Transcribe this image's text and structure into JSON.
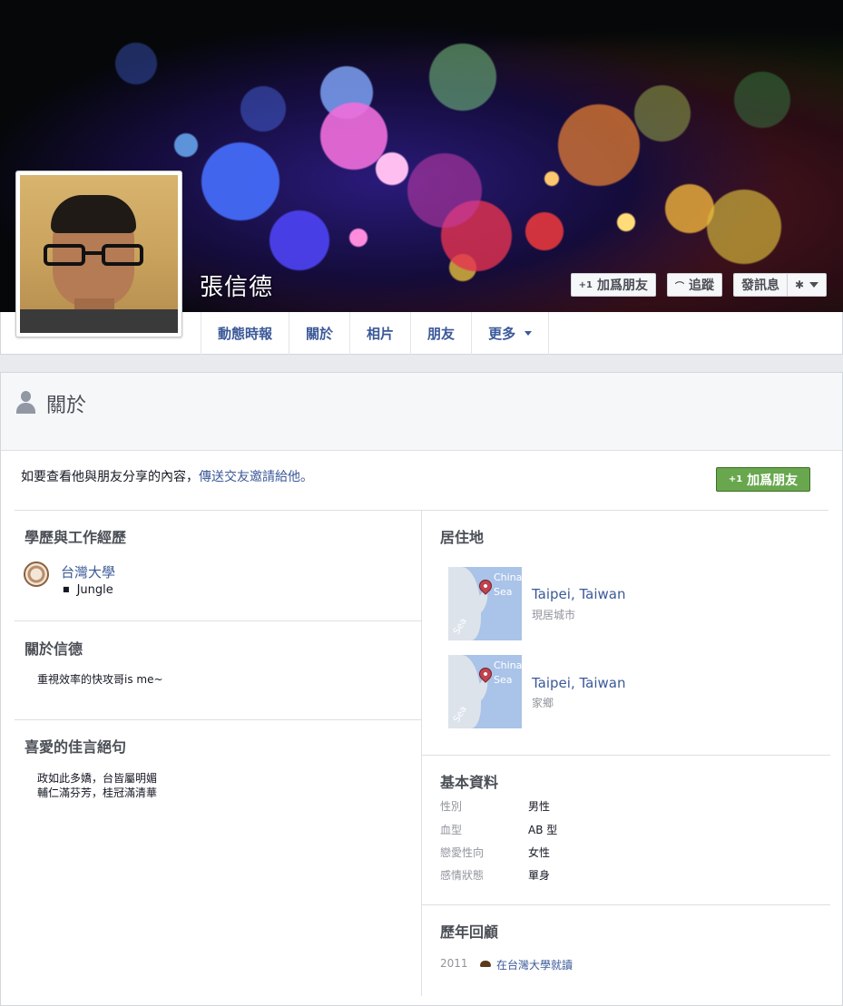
{
  "profile": {
    "name": "張信德",
    "avatar_icon": "profile-photo"
  },
  "cover_actions": {
    "add_friend": {
      "label": "加爲朋友",
      "icon": "+1"
    },
    "follow": {
      "label": "追蹤",
      "icon": "rss-icon"
    },
    "message": {
      "label": "發訊息"
    },
    "settings": {
      "icon": "gear-icon"
    }
  },
  "tabs": [
    {
      "label": "動態時報"
    },
    {
      "label": "關於"
    },
    {
      "label": "相片"
    },
    {
      "label": "朋友"
    },
    {
      "label": "更多"
    }
  ],
  "about": {
    "title": "關於",
    "invite_text": "如要查看他與朋友分享的內容，",
    "invite_link": "傳送交友邀請給他",
    "invite_end": "。",
    "add_friend_button": "加爲朋友",
    "add_friend_icon": "+1"
  },
  "education": {
    "title": "學歷與工作經歷",
    "school": "台灣大學",
    "detail": "Jungle"
  },
  "about_person": {
    "title": "關於信德",
    "text": "重視效率的快攻哥is me~"
  },
  "quotes": {
    "title": "喜愛的佳言絕句",
    "lines": [
      "政如此多嬌，台皆屬明媚",
      "輔仁滿芬芳，桂冠滿清華"
    ]
  },
  "residence": {
    "title": "居住地",
    "places": [
      {
        "name": "Taipei, Taiwan",
        "type": "現居城市",
        "map_label_1": "China",
        "map_label_2": "Sea",
        "map_label_3": "Sea"
      },
      {
        "name": "Taipei, Taiwan",
        "type": "家鄉",
        "map_label_1": "China",
        "map_label_2": "Sea",
        "map_label_3": "Sea"
      }
    ]
  },
  "basic_info": {
    "title": "基本資料",
    "rows": [
      {
        "key": "性別",
        "value": "男性"
      },
      {
        "key": "血型",
        "value": "AB 型"
      },
      {
        "key": "戀愛性向",
        "value": "女性"
      },
      {
        "key": "感情狀態",
        "value": "單身"
      }
    ]
  },
  "life_events": {
    "title": "歷年回顧",
    "year": "2011",
    "event": "在台灣大學就讀"
  },
  "colors": {
    "link": "#3b5998",
    "green_button": "#69a74e"
  }
}
